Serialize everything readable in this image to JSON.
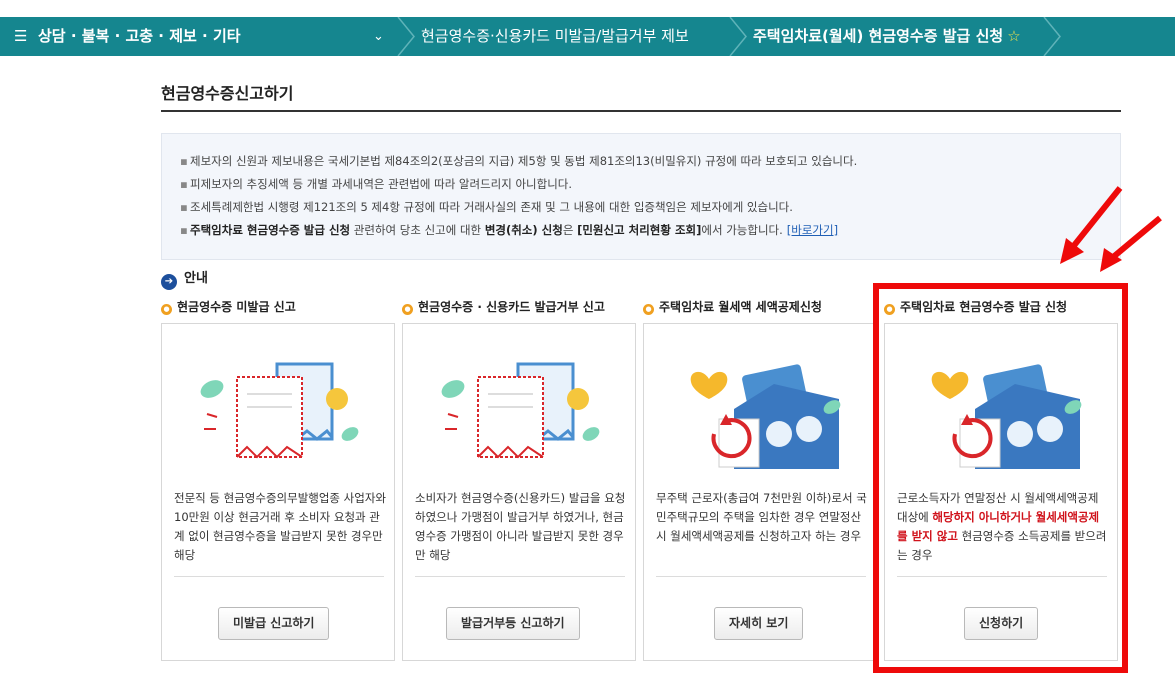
{
  "breadcrumb": {
    "menu_icon": "☰",
    "level1": "상담 · 불복 · 고충 · 제보 · 기타",
    "dropdown_icon": "⌄",
    "level2": "현금영수증·신용카드 미발급/발급거부 제보",
    "level3": "주택임차료(월세) 현금영수증 발급 신청",
    "star_icon": "☆"
  },
  "page_title": "현금영수증신고하기",
  "notice": {
    "bullet": "▪",
    "line1": "제보자의 신원과 제보내용은 국세기본법 제84조의2(포상금의 지급) 제5항 및 동법 제81조의13(비밀유지) 규정에 따라 보호되고 있습니다.",
    "line2": "피제보자의 추징세액 등 개별 과세내역은 관련법에 따라 알려드리지 아니합니다.",
    "line3": "조세특례제한법 시행령 제121조의 5 제4항 규정에 따라 거래사실의 존재 및 그 내용에 대한 입증책임은 제보자에게 있습니다.",
    "line4_a": "주택임차료 현금영수증 발급 신청",
    "line4_b": " 관련하여 당초 신고에 대한 ",
    "line4_c": "변경(취소) 신청",
    "line4_d": "은 ",
    "line4_e": "[민원신고 처리현황 조회]",
    "line4_f": "에서 가능합니다.",
    "link": "[바로가기]"
  },
  "guide": {
    "icon": "➔",
    "label": "안내"
  },
  "cards": [
    {
      "heading": "현금영수증 미발급 신고",
      "desc": "전문직 등 현금영수증의무발행업종 사업자와 10만원 이상 현금거래 후 소비자 요청과 관계 없이 현금영수증을 발급받지 못한 경우만 해당",
      "button": "미발급 신고하기"
    },
    {
      "heading": "현금영수증 · 신용카드 발급거부 신고",
      "desc": "소비자가 현금영수증(신용카드) 발급을 요청하였으나 가맹점이 발급거부 하였거나, 현금영수증 가맹점이 아니라 발급받지 못한 경우만 해당",
      "button": "발급거부등 신고하기"
    },
    {
      "heading": "주택임차료 월세액 세액공제신청",
      "desc": "무주택 근로자(총급여 7천만원 이하)로서 국민주택규모의 주택을 임차한 경우 연말정산시 월세액세액공제를 신청하고자 하는 경우",
      "button": "자세히 보기"
    },
    {
      "heading": "주택임차료 현금영수증 발급 신청",
      "desc_a": "근로소득자가 연말정산 시 월세액세액공제 대상에 ",
      "desc_b": "해당하지 아니하거나 월세세액공제를 받지 않고",
      "desc_c": " 현금영수증 소득공제를 받으려는 경우",
      "button": "신청하기"
    }
  ],
  "colors": {
    "topbar": "#15868f",
    "highlight": "#ee0a0a",
    "accent_red": "#d0121b",
    "bullet_orange": "#f0a020"
  }
}
